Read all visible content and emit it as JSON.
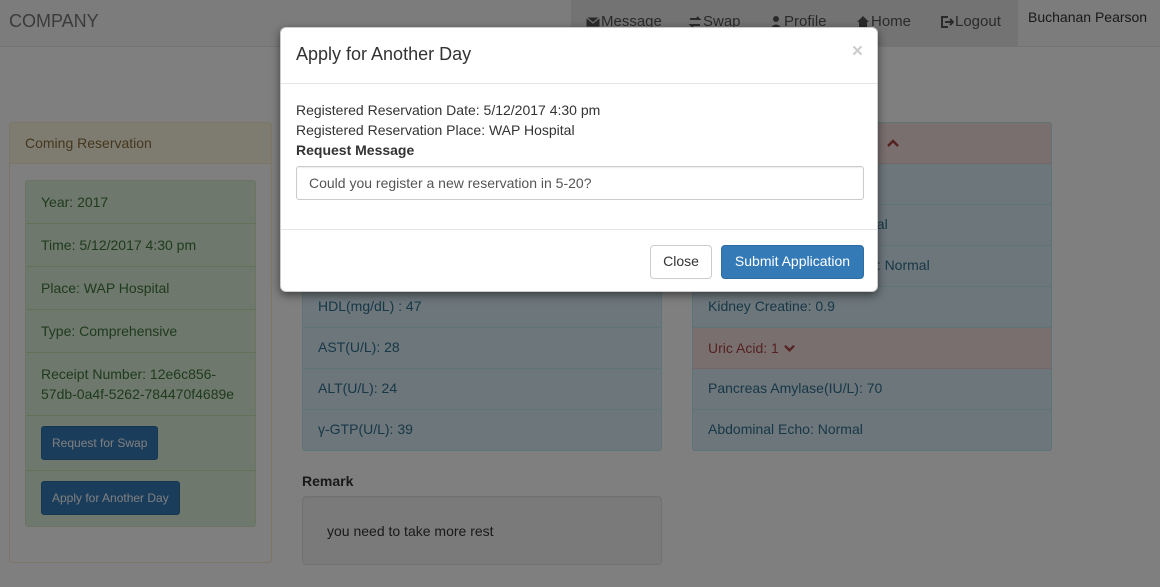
{
  "navbar": {
    "brand": "COMPANY",
    "items": [
      {
        "label": "Message",
        "icon": "envelope-icon"
      },
      {
        "label": "Swap",
        "icon": "swap-icon"
      },
      {
        "label": "Profile",
        "icon": "user-icon"
      },
      {
        "label": "Home",
        "icon": "home-icon"
      },
      {
        "label": "Logout",
        "icon": "logout-icon"
      }
    ],
    "user": "Buchanan Pearson"
  },
  "coming": {
    "title": "Coming Reservation",
    "rows": [
      "Year: 2017",
      "Time: 5/12/2017 4:30 pm",
      "Place: WAP Hospital",
      "Type: Comprehensive",
      "Receipt Number: 12e6c856-57db-0a4f-5262-784470f4689e"
    ],
    "swap_button": "Request for Swap",
    "another_button": "Apply for Another Day"
  },
  "middle": {
    "rows": [
      "HDL(mg/dL) : 47",
      "AST(U/L): 28",
      "ALT(U/L): 24",
      "γ-GTP(U/L): 39"
    ]
  },
  "right": {
    "partial_rows": [
      "nal",
      "e: Normal"
    ],
    "rows": [
      "Kidney Creatine: 0.9",
      "Uric Acid: 1",
      "Pancreas Amylase(IU/L): 70",
      "Abdominal Echo: Normal"
    ]
  },
  "remark": {
    "title": "Remark",
    "text": "you need to take more rest"
  },
  "modal": {
    "title": "Apply for Another Day",
    "close_symbol": "×",
    "date_line": "Registered Reservation Date: 5/12/2017 4:30 pm",
    "place_line": "Registered Reservation Place: WAP Hospital",
    "message_label": "Request Message",
    "message_value": "Could you register a new reservation in 5-20?",
    "close_button": "Close",
    "submit_button": "Submit Application"
  },
  "colors": {
    "primary": "#337ab7",
    "warning_bg": "#fcf8e3",
    "success_bg": "#dff0d8",
    "info_bg": "#d9edf7",
    "danger_bg": "#f2dede"
  }
}
